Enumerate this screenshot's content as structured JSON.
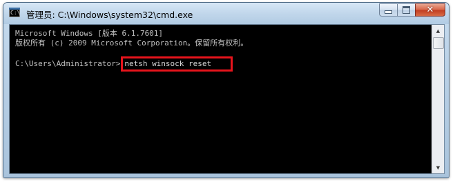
{
  "window": {
    "title": "管理员: C:\\Windows\\system32\\cmd.exe",
    "icon": "cmd-icon",
    "icon_text": "C:\\"
  },
  "caption_buttons": {
    "minimize_icon": "minimize-icon",
    "maximize_icon": "maximize-icon",
    "close_icon": "close-icon",
    "close_glyph": "✕"
  },
  "console": {
    "lines": [
      "Microsoft Windows [版本 6.1.7601]",
      "版权所有 (c) 2009 Microsoft Corporation。保留所有权利。"
    ],
    "prompt": "C:\\Users\\Administrator>",
    "command": "netsh winsock reset",
    "text_color": "#c0c0c0",
    "background": "#000000",
    "highlight_color": "#e8141c"
  },
  "scrollbar": {
    "up_arrow": "▲",
    "down_arrow": "▼"
  }
}
